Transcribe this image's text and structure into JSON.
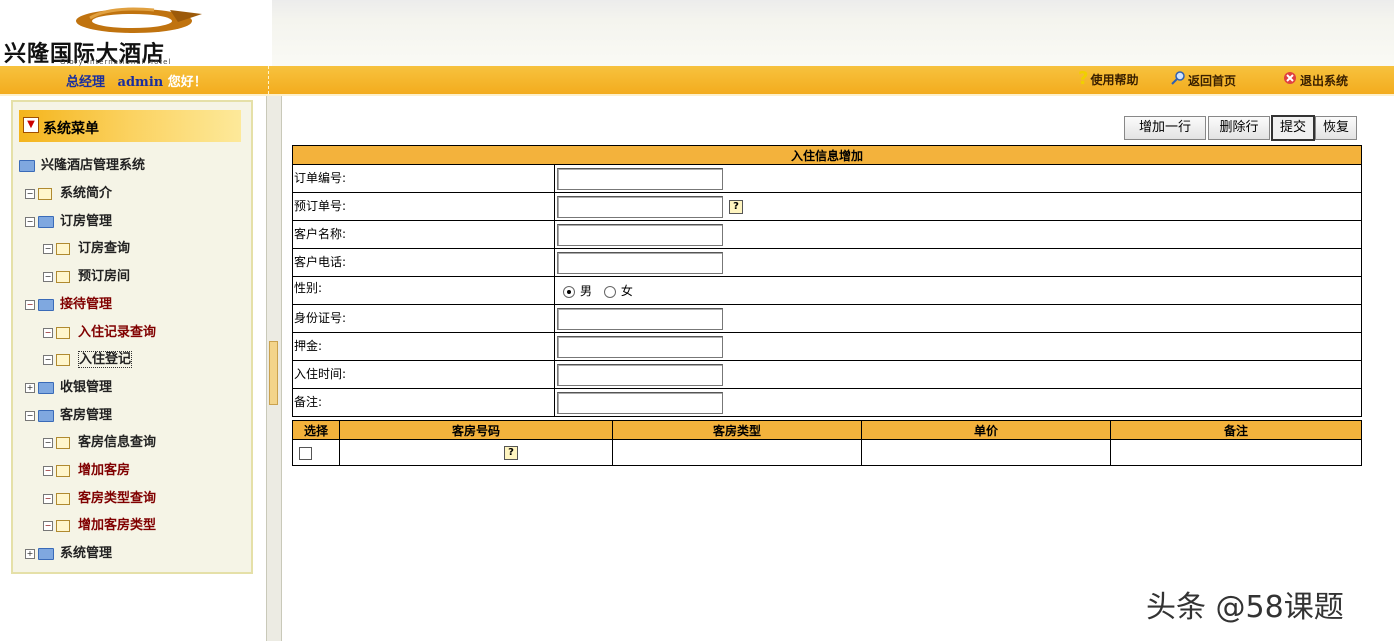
{
  "header": {
    "logo_text": "兴隆国际大酒店",
    "logo_subtext": "Glory International Hotel",
    "greeting_role": "总经理",
    "greeting_user": "admin",
    "greeting_suffix": "您好！",
    "links": [
      {
        "label": "使用帮助",
        "icon": "question-icon"
      },
      {
        "label": "返回首页",
        "icon": "search-icon"
      },
      {
        "label": "退出系统",
        "icon": "close-icon"
      }
    ]
  },
  "sidebar": {
    "title": "系统菜单",
    "root": "兴隆酒店管理系统",
    "items": [
      {
        "label": "系统简介",
        "level": 1,
        "toggle": "−",
        "type": "page"
      },
      {
        "label": "订房管理",
        "level": 1,
        "toggle": "−",
        "type": "folder"
      },
      {
        "label": "订房查询",
        "level": 2,
        "toggle": "−",
        "type": "page"
      },
      {
        "label": "预订房间",
        "level": 2,
        "toggle": "−",
        "type": "page"
      },
      {
        "label": "接待管理",
        "level": 1,
        "toggle": "−",
        "type": "folder"
      },
      {
        "label": "入住记录查询",
        "level": 2,
        "toggle": "−",
        "type": "page"
      },
      {
        "label": "入住登记",
        "level": 2,
        "toggle": "−",
        "type": "page"
      },
      {
        "label": "收银管理",
        "level": 1,
        "toggle": "+",
        "type": "folder"
      },
      {
        "label": "客房管理",
        "level": 1,
        "toggle": "−",
        "type": "folder"
      },
      {
        "label": "客房信息查询",
        "level": 2,
        "toggle": "−",
        "type": "page"
      },
      {
        "label": "增加客房",
        "level": 2,
        "toggle": "−",
        "type": "page"
      },
      {
        "label": "客房类型查询",
        "level": 2,
        "toggle": "−",
        "type": "page"
      },
      {
        "label": "增加客房类型",
        "level": 2,
        "toggle": "−",
        "type": "page"
      },
      {
        "label": "系统管理",
        "level": 1,
        "toggle": "+",
        "type": "folder"
      }
    ]
  },
  "toolbar": {
    "add_row": "增加一行",
    "delete_row": "删除行",
    "submit": "提交",
    "reset": "恢复"
  },
  "form": {
    "title": "入住信息增加",
    "fields": {
      "order_no": "订单编号:",
      "reservation_no": "预订单号:",
      "customer_name": "客户名称:",
      "customer_phone": "客户电话:",
      "gender": "性别:",
      "id_card": "身份证号:",
      "deposit": "押金:",
      "checkin_time": "入住时间:",
      "remark": "备注:"
    },
    "gender_options": [
      "男",
      "女"
    ],
    "gender_selected": "男",
    "help_icon": "?"
  },
  "rooms_table": {
    "columns": [
      "选择",
      "客房号码",
      "客房类型",
      "单价",
      "备注"
    ]
  },
  "watermark": "头条 @58课题",
  "colors": {
    "accent": "#f3b23c",
    "header_bar": "#f5b52a",
    "link_blue": "#1a2e9e",
    "menu_red": "#800000"
  }
}
